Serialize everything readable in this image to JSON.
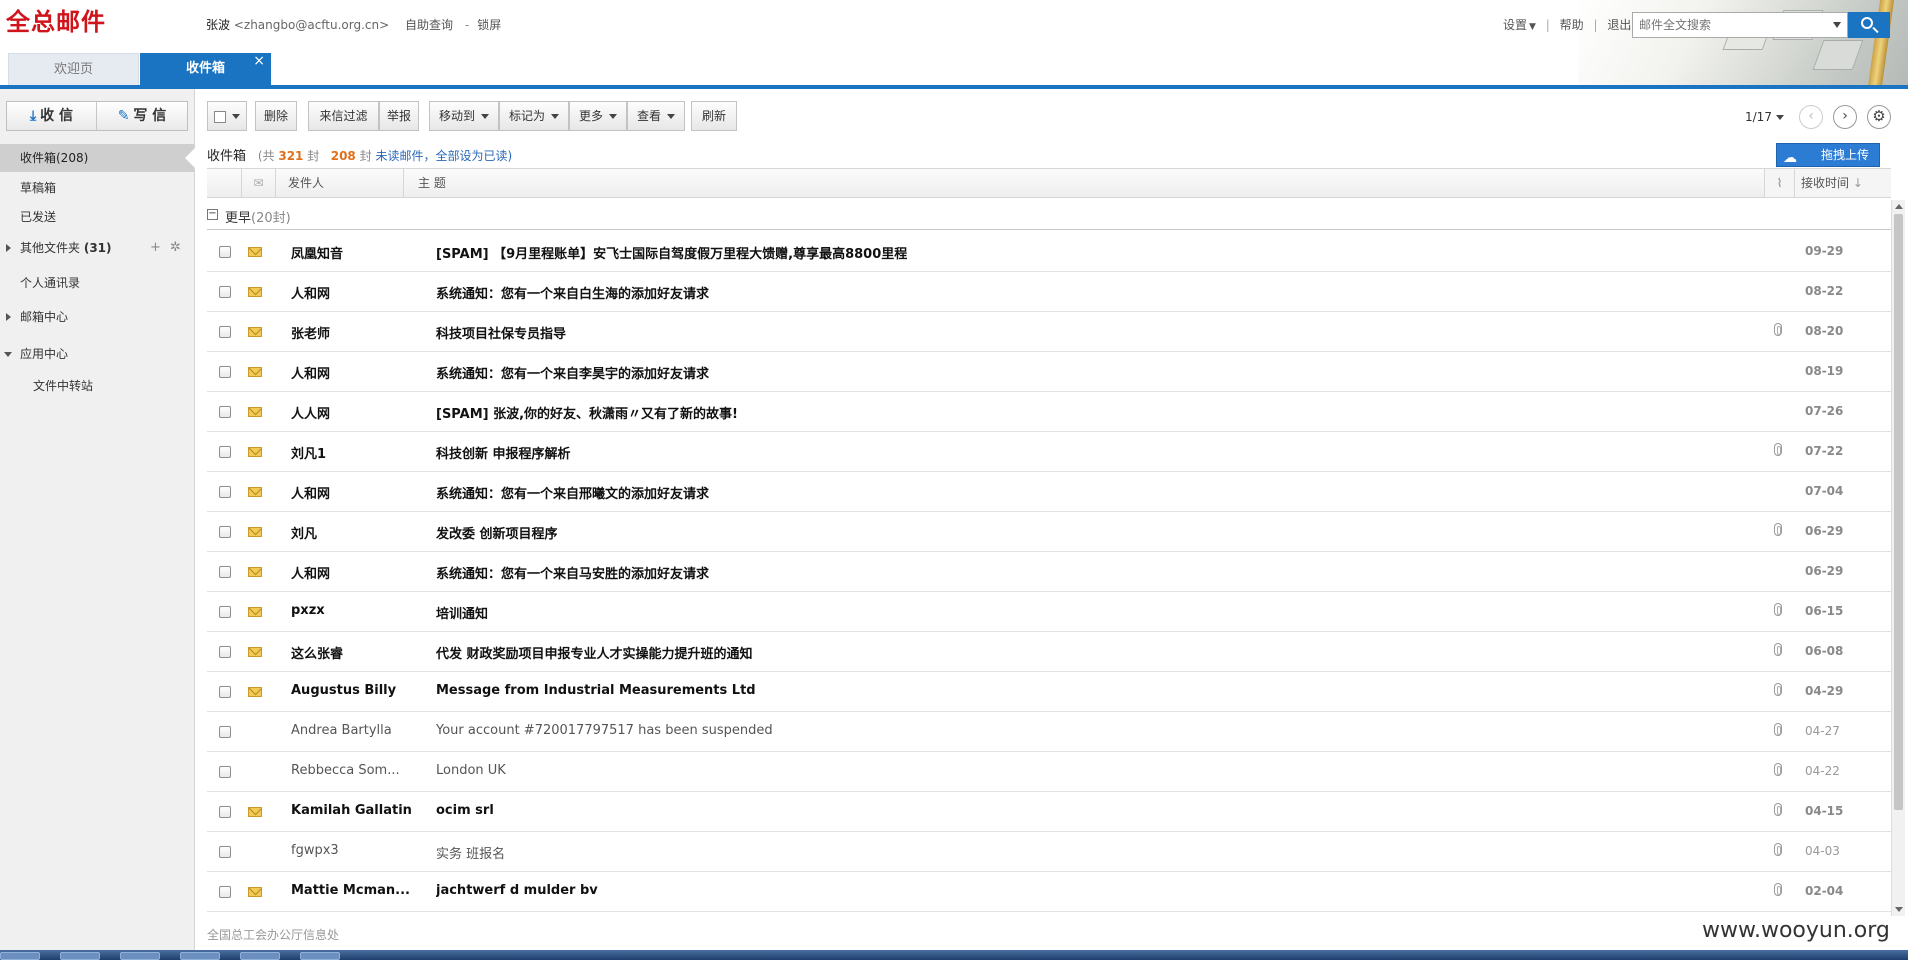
{
  "header": {
    "logo": "全总邮件",
    "user_name": "张波",
    "user_email": "<zhangbo@acftu.org.cn>",
    "self_service": "自助查询",
    "separator": "-",
    "lock_screen": "锁屏",
    "settings": "设置",
    "help": "帮助",
    "logout": "退出",
    "link_sep": "|",
    "search_placeholder": "邮件全文搜索"
  },
  "tabs": {
    "welcome": "欢迎页",
    "inbox": "收件箱",
    "close": "×"
  },
  "sidebar": {
    "receive": "收 信",
    "write": "写 信",
    "inbox": "收件箱(208)",
    "drafts": "草稿箱",
    "sent": "已发送",
    "other_folders": "其他文件夹",
    "other_count": "(31)",
    "add": "+",
    "gear": "✲",
    "contacts": "个人通讯录",
    "mailbox_center": "邮箱中心",
    "app_center": "应用中心",
    "file_transfer": "文件中转站"
  },
  "toolbar": {
    "delete": "删除",
    "filter": "来信过滤",
    "report": "举报",
    "move_to": "移动到",
    "mark_as": "标记为",
    "more": "更多",
    "view": "查看",
    "refresh": "刷新",
    "page": "1/17",
    "prev": "‹",
    "next": "›",
    "settings": "⚙"
  },
  "summary": {
    "title": "收件箱",
    "total_prefix": "(共",
    "total": "321",
    "total_suffix": "封",
    "unread": "208",
    "unread_suffix": "封",
    "unread_link": "未读邮件",
    "mark_all": "，全部设为已读)",
    "upload": "拖拽上传"
  },
  "list_header": {
    "sender": "发件人",
    "subject": "主 题",
    "time": "接收时间",
    "sort_icon": "↓"
  },
  "group": {
    "toggle": "−",
    "label": "更早",
    "count": "(20封)"
  },
  "mails": [
    {
      "sender": "凤凰知音",
      "subject": "[SPAM] 【9月里程账单】安飞士国际自驾度假万里程大馈赠,尊享最高8800里程",
      "time": "09-29",
      "unread": true,
      "attachment": false
    },
    {
      "sender": "人和网",
      "subject": "系统通知：您有一个来自白生海的添加好友请求",
      "time": "08-22",
      "unread": true,
      "attachment": false
    },
    {
      "sender": "张老师",
      "subject": "科技项目社保专员指导",
      "time": "08-20",
      "unread": true,
      "attachment": true
    },
    {
      "sender": "人和网",
      "subject": "系统通知：您有一个来自李昊宇的添加好友请求",
      "time": "08-19",
      "unread": true,
      "attachment": false
    },
    {
      "sender": "人人网",
      "subject": "[SPAM] 张波,你的好友、秋潇雨〃又有了新的故事!",
      "time": "07-26",
      "unread": true,
      "attachment": false
    },
    {
      "sender": "刘凡1",
      "subject": "科技创新 申报程序解析",
      "time": "07-22",
      "unread": true,
      "attachment": true
    },
    {
      "sender": "人和网",
      "subject": "系统通知：您有一个来自邢曦文的添加好友请求",
      "time": "07-04",
      "unread": true,
      "attachment": false
    },
    {
      "sender": "刘凡",
      "subject": "发改委 创新项目程序",
      "time": "06-29",
      "unread": true,
      "attachment": true
    },
    {
      "sender": "人和网",
      "subject": "系统通知：您有一个来自马安胜的添加好友请求",
      "time": "06-29",
      "unread": true,
      "attachment": false
    },
    {
      "sender": "pxzx",
      "subject": "培训通知",
      "time": "06-15",
      "unread": true,
      "attachment": true
    },
    {
      "sender": "这么张睿",
      "subject": "代发 财政奖励项目申报专业人才实操能力提升班的通知",
      "time": "06-08",
      "unread": true,
      "attachment": true
    },
    {
      "sender": "Augustus Billy",
      "subject": "Message from Industrial Measurements Ltd",
      "time": "04-29",
      "unread": true,
      "attachment": true
    },
    {
      "sender": "Andrea Bartylla",
      "subject": "Your account #720017797517 has been suspended",
      "time": "04-27",
      "unread": false,
      "attachment": true
    },
    {
      "sender": "Rebbecca Som...",
      "subject": "London UK",
      "time": "04-22",
      "unread": false,
      "attachment": true
    },
    {
      "sender": "Kamilah Gallatin",
      "subject": "ocim srl",
      "time": "04-15",
      "unread": true,
      "attachment": true
    },
    {
      "sender": "fgwpx3",
      "subject": "实务 班报名",
      "time": "04-03",
      "unread": false,
      "attachment": true
    },
    {
      "sender": "Mattie Mcman...",
      "subject": "jachtwerf d mulder bv",
      "time": "02-04",
      "unread": true,
      "attachment": true
    }
  ],
  "footer": {
    "text": "全国总工会办公厅信息处",
    "watermark": "www.wooyun.org"
  }
}
